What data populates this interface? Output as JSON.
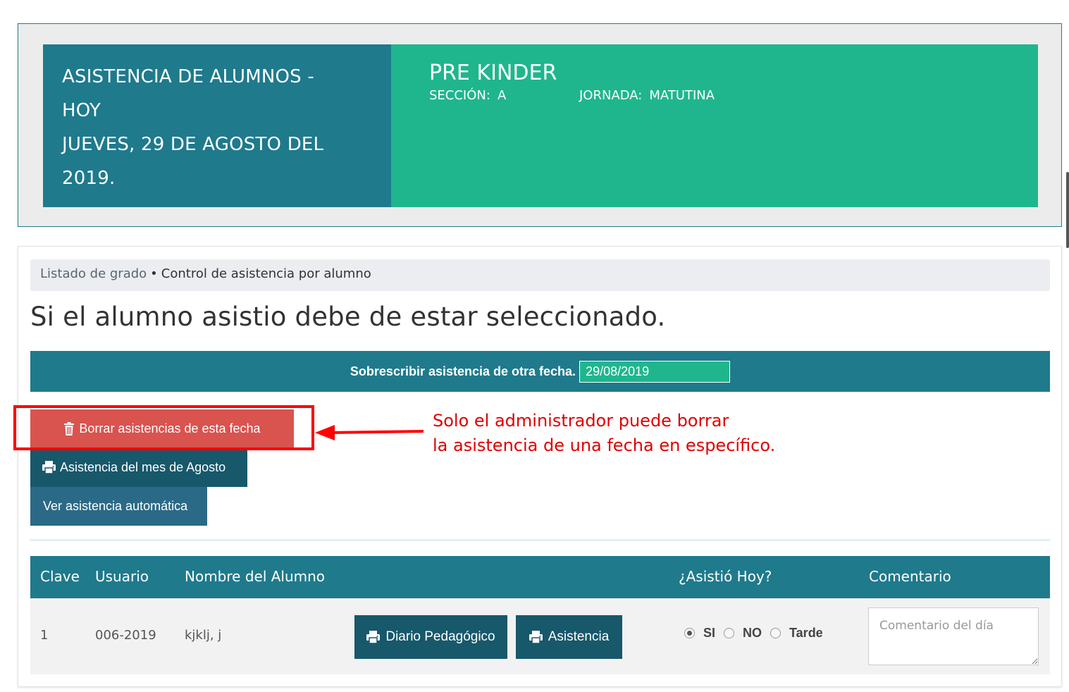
{
  "banner": {
    "title_line1": "ASISTENCIA DE ALUMNOS -",
    "title_line2": "HOY",
    "date_line1": "JUEVES, 29 DE AGOSTO DEL",
    "date_line2": "2019.",
    "grade": "PRE KINDER",
    "section_label": "SECCIÓN:",
    "section_value": "A",
    "shift_label": "JORNADA:",
    "shift_value": "MATUTINA"
  },
  "breadcrumb": {
    "link": "Listado de grado",
    "separator": "•",
    "current": "Control de asistencia por alumno"
  },
  "heading": "Si el alumno asistio debe de estar seleccionado.",
  "date_override": {
    "label": "Sobrescribir asistencia de otra fecha.",
    "value": "29/08/2019"
  },
  "buttons": {
    "delete": "Borrar asistencias de esta fecha",
    "month": "Asistencia del mes de Agosto",
    "auto": "Ver asistencia automática"
  },
  "annotation": {
    "line1": "Solo el administrador puede borrar",
    "line2": "la asistencia de una fecha en específico."
  },
  "table": {
    "headers": {
      "key": "Clave",
      "user": "Usuario",
      "name": "Nombre del Alumno",
      "attended": "¿Asistió Hoy?",
      "comment": "Comentario"
    },
    "rows": [
      {
        "key": "1",
        "user": "006-2019",
        "name": "kjklj, j",
        "diary_button": "Diario Pedagógico",
        "attendance_button": "Asistencia",
        "options": [
          "SI",
          "NO",
          "Tarde"
        ],
        "selected": "SI",
        "comment_placeholder": "Comentario del día"
      }
    ]
  },
  "colors": {
    "teal_dark": "#1f7a8c",
    "green": "#1fb68d",
    "danger": "#d9534f",
    "button_dark": "#17586b",
    "annotation_red": "#e00000"
  }
}
